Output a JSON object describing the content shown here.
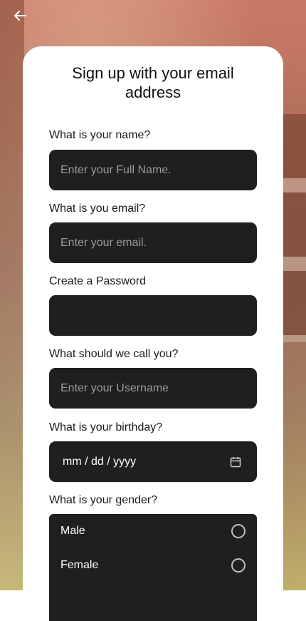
{
  "header": {
    "back_icon": "arrow-left-icon"
  },
  "form": {
    "title": "Sign up with your email address",
    "name": {
      "label": "What is your name?",
      "placeholder": "Enter your Full Name."
    },
    "email": {
      "label": "What is you email?",
      "placeholder": "Enter your email."
    },
    "password": {
      "label": "Create a Password",
      "placeholder": ""
    },
    "username": {
      "label": "What should we call you?",
      "placeholder": "Enter your Username"
    },
    "birthday": {
      "label": "What is your birthday?",
      "placeholder": "mm / dd / yyyy",
      "icon": "calendar-icon"
    },
    "gender": {
      "label": "What is your gender?",
      "options": [
        "Male",
        "Female"
      ]
    }
  },
  "colors": {
    "field_bg": "#1f1f1f",
    "card_bg": "#ffffff"
  }
}
